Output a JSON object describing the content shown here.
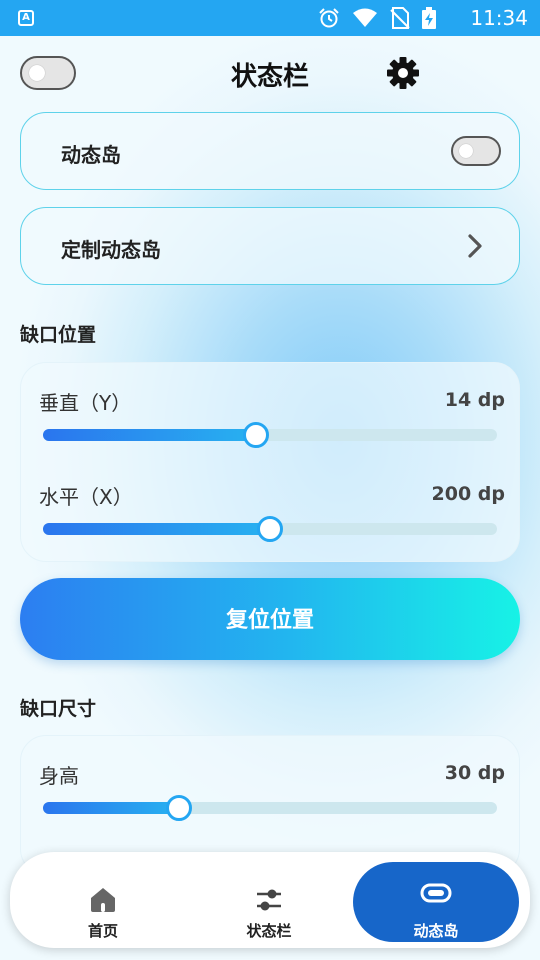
{
  "status_bar": {
    "time": "11:34",
    "app_glyph": "A"
  },
  "header": {
    "title": "状态栏",
    "master_toggle_on": false
  },
  "dynamic_island_row": {
    "label": "动态岛",
    "toggle_on": false
  },
  "custom_island_row": {
    "label": "定制动态岛"
  },
  "notch_position": {
    "title": "缺口位置",
    "vertical": {
      "label": "垂直（Y）",
      "value_text": "14 dp",
      "fraction": 0.47
    },
    "horizontal": {
      "label": "水平（X）",
      "value_text": "200 dp",
      "fraction": 0.5
    }
  },
  "reset_button": {
    "label": "复位位置"
  },
  "notch_size": {
    "title": "缺口尺寸",
    "height": {
      "label": "身高",
      "value_text": "30 dp",
      "fraction": 0.3
    }
  },
  "bottom_nav": {
    "items": [
      {
        "label": "首页",
        "icon": "home-icon",
        "active": false
      },
      {
        "label": "状态栏",
        "icon": "sliders-icon",
        "active": false
      },
      {
        "label": "动态岛",
        "icon": "pill-icon",
        "active": true
      }
    ]
  },
  "colors": {
    "accent": "#24a6f2",
    "nav_active": "#1766c9",
    "border": "#5ed2ea"
  }
}
